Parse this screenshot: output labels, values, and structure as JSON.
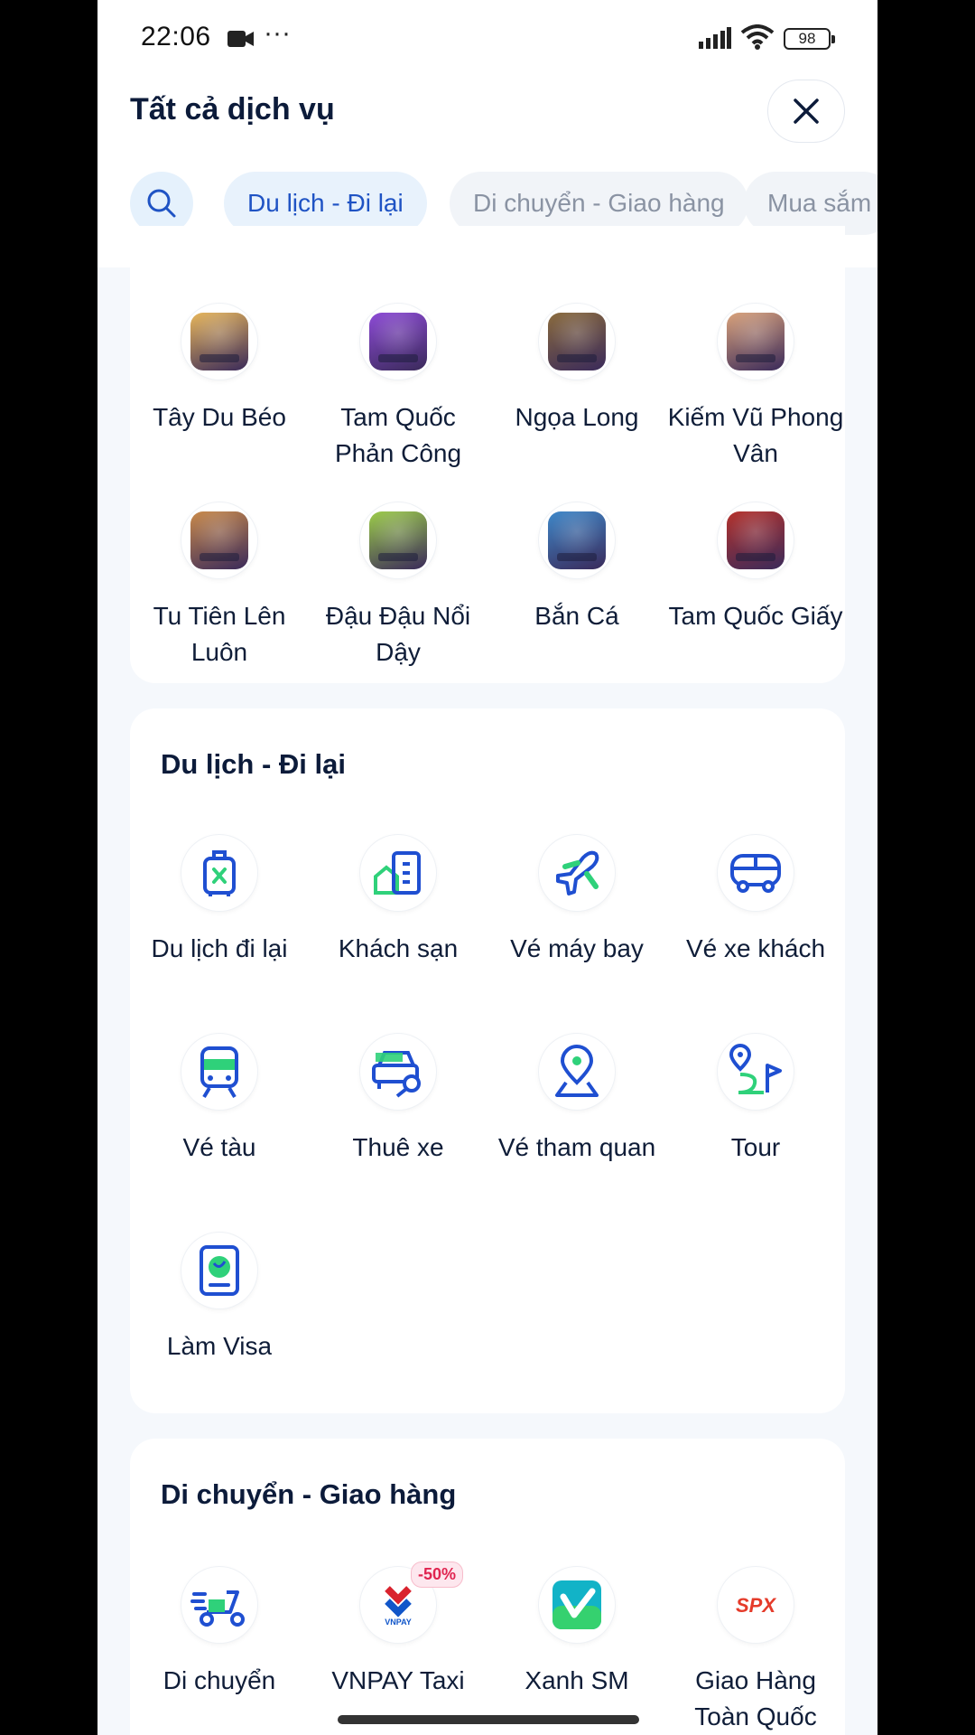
{
  "status_bar": {
    "time": "22:06",
    "battery": "98"
  },
  "header": {
    "title": "Tất cả dịch vụ"
  },
  "chips": [
    {
      "label": "Du lịch - Đi lại",
      "active": true
    },
    {
      "label": "Di chuyển - Giao hàng",
      "active": false
    },
    {
      "label": "Mua sắm",
      "active": false
    }
  ],
  "games": {
    "items": [
      {
        "label": "Tây Du Béo",
        "icon": "game-tay-du-beo",
        "color": "#e7b65b"
      },
      {
        "label": "Tam Quốc Phản Công",
        "icon": "game-tam-quoc-phan-cong",
        "color": "#8d4bd6"
      },
      {
        "label": "Ngọa Long",
        "icon": "game-ngoa-long",
        "color": "#8a6b3e"
      },
      {
        "label": "Kiếm Vũ Phong Vân",
        "icon": "game-kiem-vu-phong-van",
        "color": "#d9a27b"
      },
      {
        "label": "Tu Tiên Lên Luôn",
        "icon": "game-tu-tien-len-luon",
        "color": "#c98a4b"
      },
      {
        "label": "Đậu Đậu Nổi Dậy",
        "icon": "game-dau-dau-noi-day",
        "color": "#9ccc4a"
      },
      {
        "label": "Bắn Cá",
        "icon": "game-ban-ca",
        "color": "#3f88c9"
      },
      {
        "label": "Tam Quốc Giấy",
        "icon": "game-tam-quoc-giay",
        "color": "#b5332d"
      }
    ]
  },
  "travel": {
    "title": "Du lịch - Đi lại",
    "items": [
      {
        "label": "Du lịch đi lại",
        "icon": "luggage-icon"
      },
      {
        "label": "Khách sạn",
        "icon": "hotel-icon"
      },
      {
        "label": "Vé máy bay",
        "icon": "airplane-icon"
      },
      {
        "label": "Vé xe khách",
        "icon": "bus-icon"
      },
      {
        "label": "Vé tàu",
        "icon": "train-icon"
      },
      {
        "label": "Thuê xe",
        "icon": "car-rental-icon"
      },
      {
        "label": "Vé tham quan",
        "icon": "location-pin-icon"
      },
      {
        "label": "Tour",
        "icon": "tour-route-icon"
      },
      {
        "label": "Làm Visa",
        "icon": "passport-icon"
      }
    ]
  },
  "transport": {
    "title": "Di chuyển - Giao hàng",
    "items": [
      {
        "label": "Di chuyển",
        "icon": "scooter-icon"
      },
      {
        "label": "VNPAY Taxi",
        "icon": "vnpay-taxi-logo",
        "badge": "-50%",
        "logo_text": "VNPAY"
      },
      {
        "label": "Xanh SM",
        "icon": "xanh-sm-logo"
      },
      {
        "label": "Giao Hàng Toàn Quốc",
        "icon": "spx-logo",
        "logo_text": "SPX"
      }
    ]
  },
  "colors": {
    "primary_blue": "#1f4fd1",
    "accent_green": "#2fd17a",
    "title_text": "#0c1b3a"
  }
}
